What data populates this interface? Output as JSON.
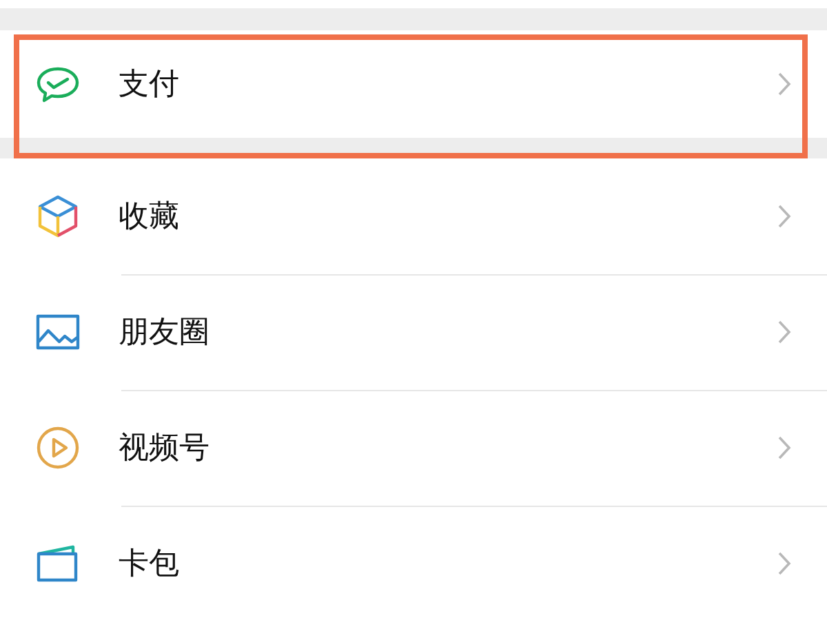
{
  "sections": [
    {
      "items": [
        {
          "label": "支付",
          "highlighted": true
        }
      ]
    },
    {
      "items": [
        {
          "label": "收藏",
          "highlighted": false
        },
        {
          "label": "朋友圈",
          "highlighted": false
        },
        {
          "label": "视频号",
          "highlighted": false
        },
        {
          "label": "卡包",
          "highlighted": false
        }
      ]
    }
  ]
}
